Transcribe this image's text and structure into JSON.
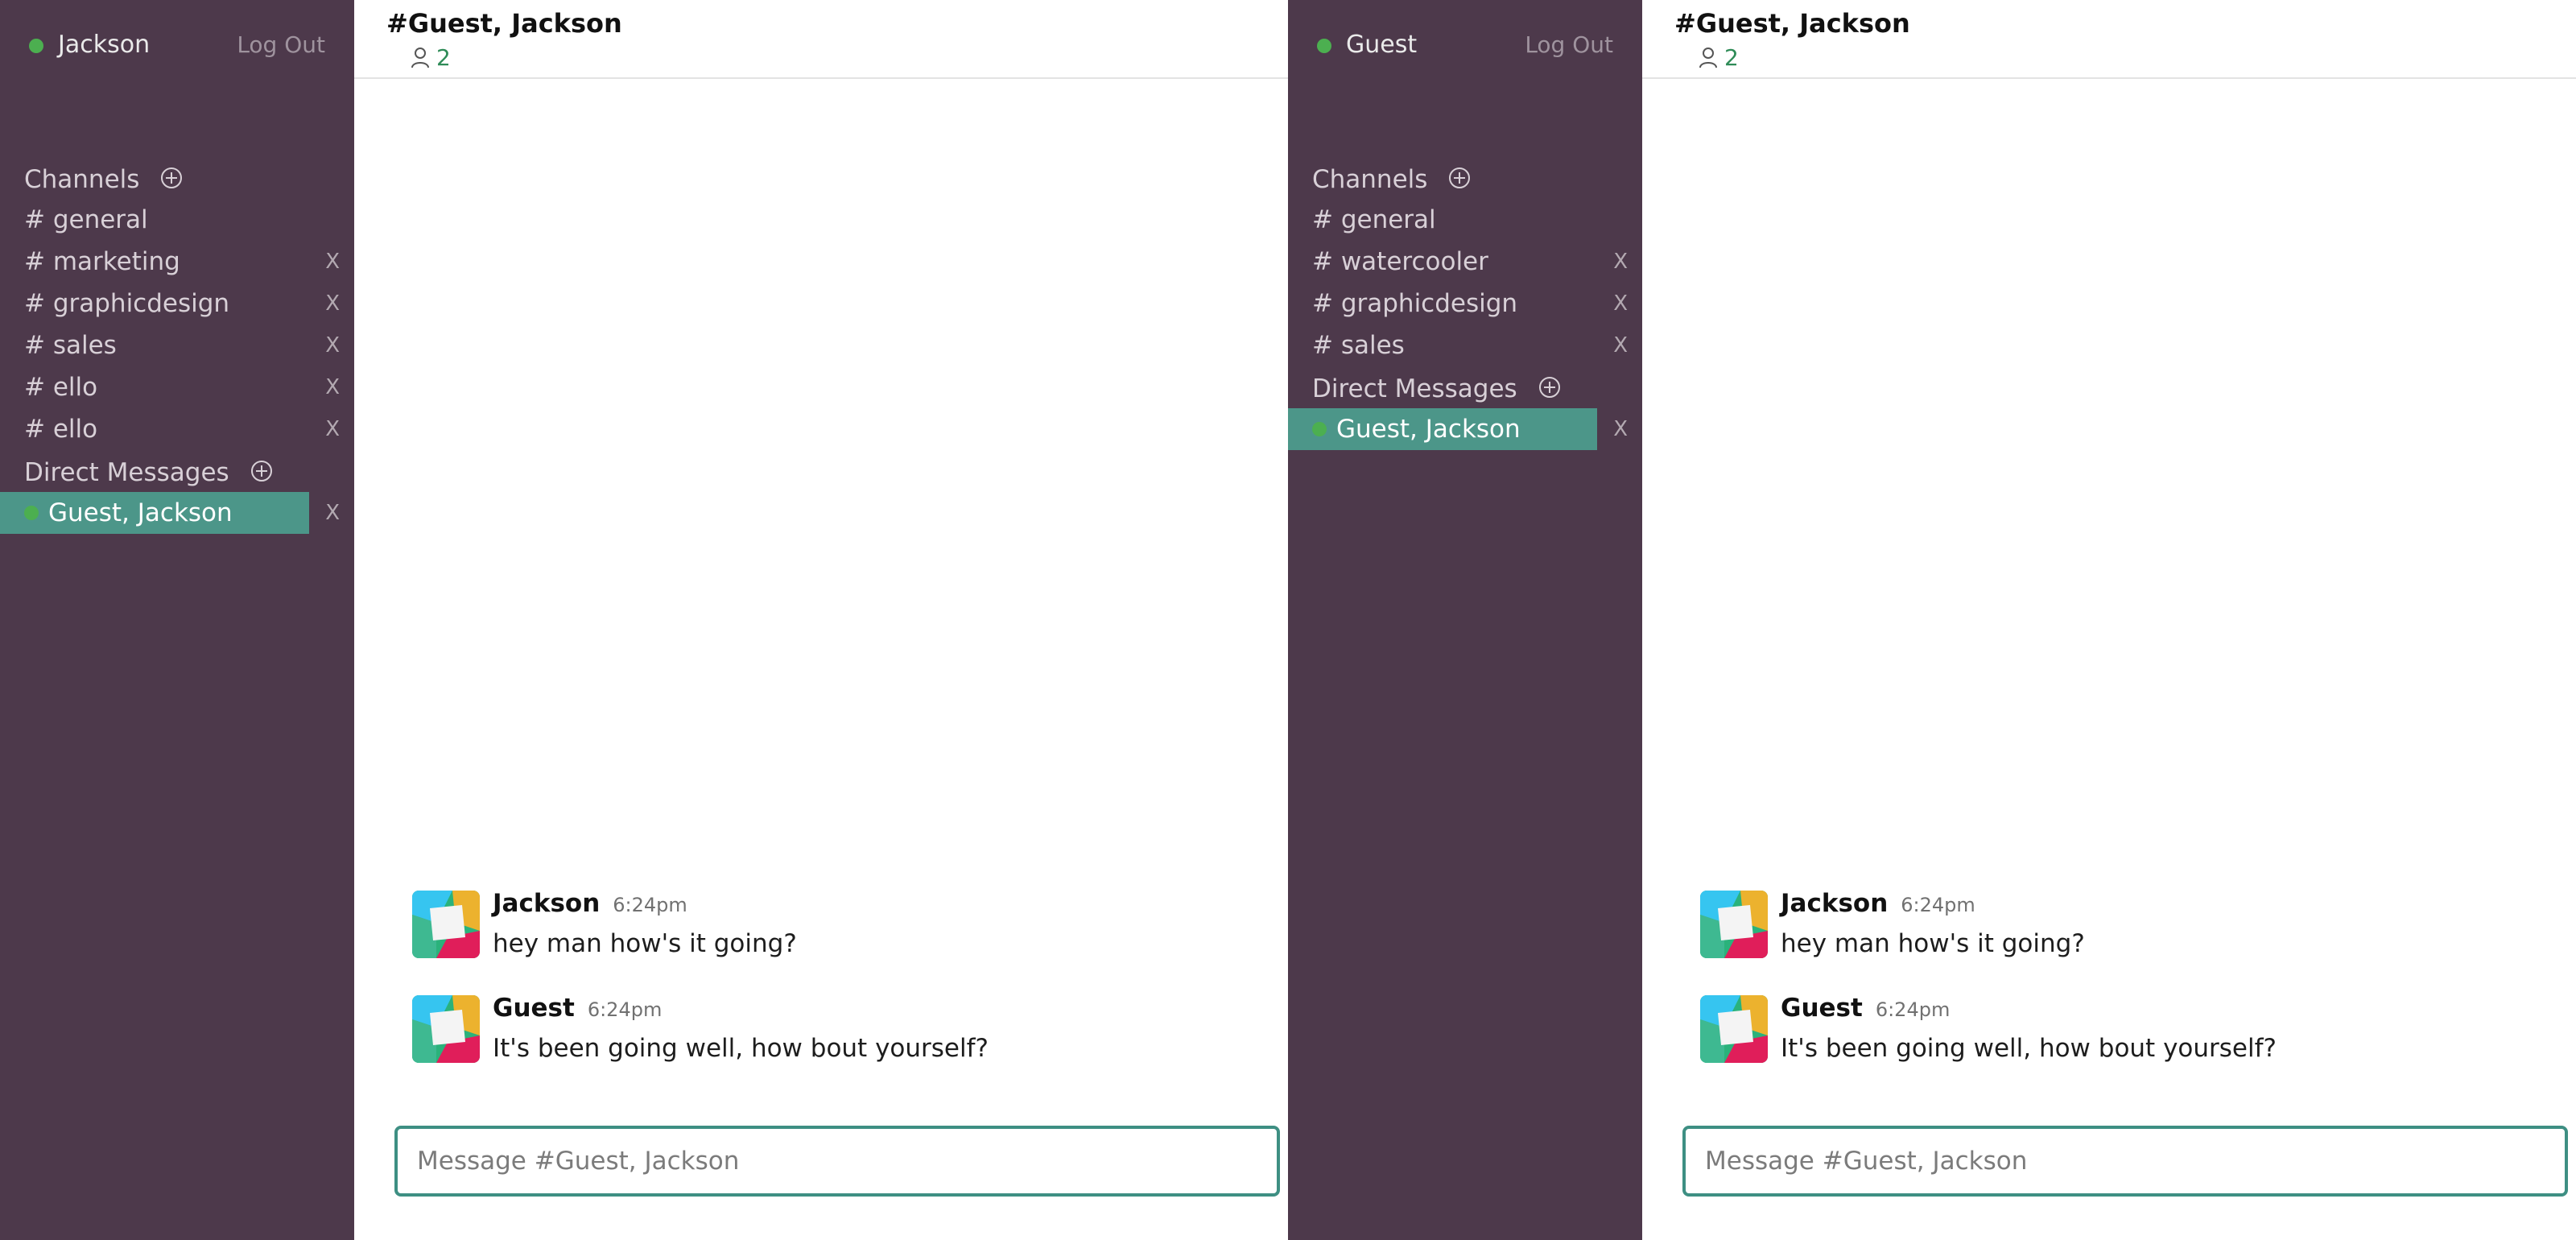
{
  "colors": {
    "sidebar_bg": "#4d394b",
    "active_item_bg": "#4c9689",
    "online_dot": "#4caf50",
    "composer_border": "#3e8f83"
  },
  "left": {
    "sidebar": {
      "username": "Jackson",
      "logout": "Log Out",
      "channels_label": "Channels",
      "channels": [
        {
          "label": "# general",
          "close": ""
        },
        {
          "label": "# marketing",
          "close": "X"
        },
        {
          "label": "# graphicdesign",
          "close": "X"
        },
        {
          "label": "# sales",
          "close": "X"
        },
        {
          "label": "# ello",
          "close": "X"
        },
        {
          "label": "# ello",
          "close": "X"
        }
      ],
      "dm_label": "Direct Messages",
      "dms": [
        {
          "label": "Guest, Jackson",
          "close": "X",
          "active": true
        }
      ]
    },
    "main": {
      "title": "#Guest, Jackson",
      "members": "2",
      "messages": [
        {
          "author": "Jackson",
          "time": "6:24pm",
          "text": "hey man how's it going?"
        },
        {
          "author": "Guest",
          "time": "6:24pm",
          "text": "It's been going well, how bout yourself?"
        }
      ],
      "composer_placeholder": "Message #Guest, Jackson"
    }
  },
  "right": {
    "sidebar": {
      "username": "Guest",
      "logout": "Log Out",
      "channels_label": "Channels",
      "channels": [
        {
          "label": "# general",
          "close": ""
        },
        {
          "label": "# watercooler",
          "close": "X"
        },
        {
          "label": "# graphicdesign",
          "close": "X"
        },
        {
          "label": "# sales",
          "close": "X"
        }
      ],
      "dm_label": "Direct Messages",
      "dms": [
        {
          "label": "Guest, Jackson",
          "close": "X",
          "active": true
        }
      ]
    },
    "main": {
      "title": "#Guest, Jackson",
      "members": "2",
      "messages": [
        {
          "author": "Jackson",
          "time": "6:24pm",
          "text": "hey man how's it going?"
        },
        {
          "author": "Guest",
          "time": "6:24pm",
          "text": "It's been going well, how bout yourself?"
        }
      ],
      "composer_placeholder": "Message #Guest, Jackson"
    }
  }
}
